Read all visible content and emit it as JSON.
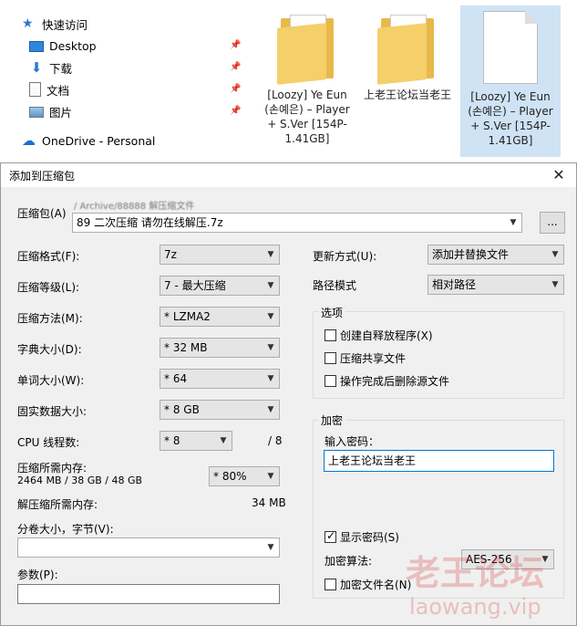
{
  "explorer": {
    "nav": [
      {
        "label": "快速访问",
        "icon": "star-icon"
      },
      {
        "label": "Desktop",
        "icon": "desktop-icon"
      },
      {
        "label": "下载",
        "icon": "download-icon"
      },
      {
        "label": "文档",
        "icon": "document-icon"
      },
      {
        "label": "图片",
        "icon": "picture-icon"
      },
      {
        "label": "OneDrive - Personal",
        "icon": "cloud-icon"
      }
    ],
    "files": [
      {
        "name": "[Loozy] Ye Eun (손예은) – Player + S.Ver [154P-1.41GB]",
        "type": "folder"
      },
      {
        "name": "上老王论坛当老王",
        "type": "folder"
      },
      {
        "name": "[Loozy] Ye Eun (손예은) – Player + S.Ver [154P-1.41GB]",
        "type": "file"
      }
    ]
  },
  "dialog": {
    "title": "添加到压缩包",
    "close_glyph": "✕",
    "archive_label": "压缩包(A)",
    "archive_path_hint": "/ Archive/88888 解压缩文件",
    "archive_value": "89 二次压缩 请勿在线解压.7z",
    "browse_label": "...",
    "format_label": "压缩格式(F):",
    "format_value": "7z",
    "level_label": "压缩等级(L):",
    "level_value": "7 - 最大压缩",
    "method_label": "压缩方法(M):",
    "method_value": "* LZMA2",
    "dict_label": "字典大小(D):",
    "dict_value": "* 32 MB",
    "word_label": "单词大小(W):",
    "word_value": "* 64",
    "solid_label": "固实数据大小:",
    "solid_value": "* 8 GB",
    "cpu_label": "CPU 线程数:",
    "cpu_value": "* 8",
    "cpu_max": "/ 8",
    "mem_label": "压缩所需内存:",
    "mem_detail": "2464 MB / 38 GB / 48 GB",
    "mem_value": "* 80%",
    "decomp_label": "解压缩所需内存:",
    "decomp_value": "34 MB",
    "volume_label": "分卷大小，字节(V):",
    "volume_value": "",
    "params_label": "参数(P):",
    "params_value": "",
    "update_label": "更新方式(U):",
    "update_value": "添加并替换文件",
    "path_label": "路径模式",
    "path_value": "相对路径",
    "options_title": "选项",
    "opt_sfx": "创建自释放程序(X)",
    "opt_shared": "压缩共享文件",
    "opt_delete": "操作完成后删除源文件",
    "encrypt_title": "加密",
    "password_label": "输入密码：",
    "password_value": "上老王论坛当老王",
    "show_password": "显示密码(S)",
    "enc_method_label": "加密算法:",
    "enc_method_value": "AES-256",
    "encrypt_names": "加密文件名(N)"
  },
  "watermark": {
    "text": "老王论坛",
    "url": "laowang.vip"
  }
}
